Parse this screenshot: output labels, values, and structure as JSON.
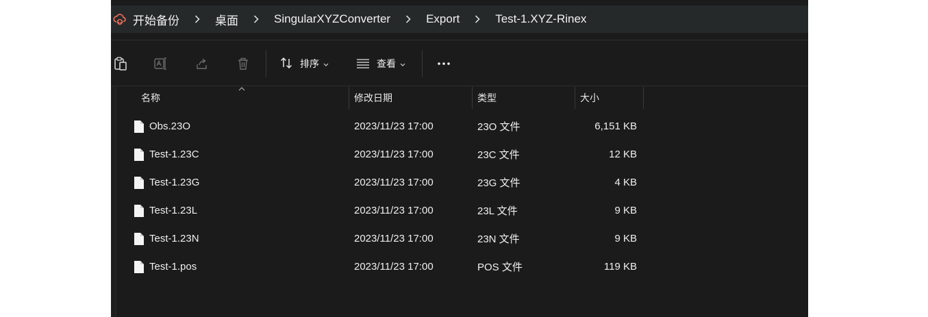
{
  "breadcrumb": {
    "items": [
      "开始备份",
      "桌面",
      "SingularXYZConverter",
      "Export",
      "Test-1.XYZ-Rinex"
    ],
    "home_icon": "cloud-backup-icon",
    "separator_icon": "chevron-right-icon"
  },
  "toolbar": {
    "paste_icon": "paste-icon",
    "rename_icon": "rename-icon",
    "share_icon": "share-icon",
    "delete_icon": "trash-icon",
    "sort_label": "排序",
    "view_label": "查看",
    "more_icon": "more-dots-icon"
  },
  "columns": {
    "name": "名称",
    "date": "修改日期",
    "type": "类型",
    "size": "大小"
  },
  "files": [
    {
      "name": "Obs.23O",
      "date": "2023/11/23 17:00",
      "type": "23O 文件",
      "size": "6,151 KB"
    },
    {
      "name": "Test-1.23C",
      "date": "2023/11/23 17:00",
      "type": "23C 文件",
      "size": "12 KB"
    },
    {
      "name": "Test-1.23G",
      "date": "2023/11/23 17:00",
      "type": "23G 文件",
      "size": "4 KB"
    },
    {
      "name": "Test-1.23L",
      "date": "2023/11/23 17:00",
      "type": "23L 文件",
      "size": "9 KB"
    },
    {
      "name": "Test-1.23N",
      "date": "2023/11/23 17:00",
      "type": "23N 文件",
      "size": "9 KB"
    },
    {
      "name": "Test-1.pos",
      "date": "2023/11/23 17:00",
      "type": "POS 文件",
      "size": "119 KB"
    }
  ],
  "colors": {
    "background": "#1b1b1b",
    "addressbar": "#25292a",
    "text": "#f0f0f0",
    "backup_icon": "#e06a5a"
  }
}
